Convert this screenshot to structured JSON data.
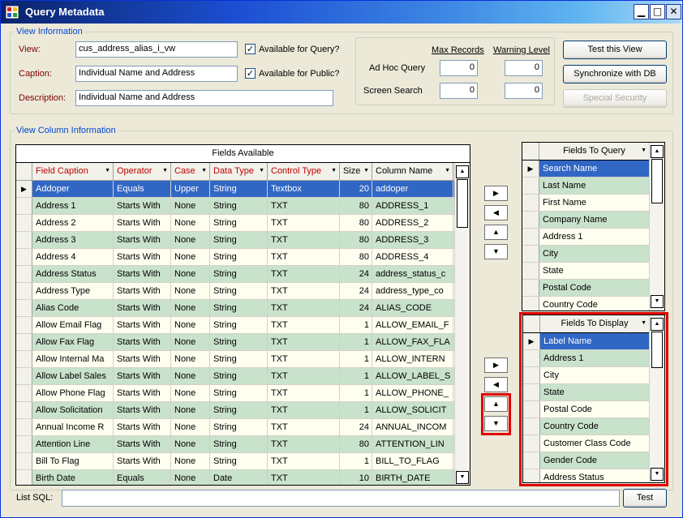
{
  "window": {
    "title": "Query Metadata"
  },
  "view_info": {
    "legend": "View Information",
    "view_label": "View:",
    "view_value": "cus_address_alias_i_vw",
    "caption_label": "Caption:",
    "caption_value": "Individual Name and Address",
    "description_label": "Description:",
    "description_value": "Individual Name and Address",
    "available_query_label": "Available for Query?",
    "available_query_checked": true,
    "available_public_label": "Available for Public?",
    "available_public_checked": true,
    "max_records_label": "Max Records",
    "warning_level_label": "Warning Level",
    "ad_hoc_label": "Ad Hoc Query",
    "screen_search_label": "Screen Search",
    "ad_hoc_max": "0",
    "ad_hoc_warning": "0",
    "screen_max": "0",
    "screen_warning": "0",
    "test_view_label": "Test this View",
    "sync_db_label": "Synchronize with DB",
    "special_security_label": "Special Security"
  },
  "column_info": {
    "legend": "View Column Information",
    "grid_title": "Fields Available",
    "columns": [
      "Field Caption",
      "Operator",
      "Case",
      "Data Type",
      "Control Type",
      "Size",
      "Column Name"
    ],
    "rows": [
      [
        "Addoper",
        "Equals",
        "Upper",
        "String",
        "Textbox",
        "20",
        "addoper"
      ],
      [
        "Address 1",
        "Starts With",
        "None",
        "String",
        "TXT",
        "80",
        "ADDRESS_1"
      ],
      [
        "Address 2",
        "Starts With",
        "None",
        "String",
        "TXT",
        "80",
        "ADDRESS_2"
      ],
      [
        "Address 3",
        "Starts With",
        "None",
        "String",
        "TXT",
        "80",
        "ADDRESS_3"
      ],
      [
        "Address 4",
        "Starts With",
        "None",
        "String",
        "TXT",
        "80",
        "ADDRESS_4"
      ],
      [
        "Address Status",
        "Starts With",
        "None",
        "String",
        "TXT",
        "24",
        "address_status_c"
      ],
      [
        "Address Type",
        "Starts With",
        "None",
        "String",
        "TXT",
        "24",
        "address_type_co"
      ],
      [
        "Alias Code",
        "Starts With",
        "None",
        "String",
        "TXT",
        "24",
        "ALIAS_CODE"
      ],
      [
        "Allow Email Flag",
        "Starts With",
        "None",
        "String",
        "TXT",
        "1",
        "ALLOW_EMAIL_F"
      ],
      [
        "Allow Fax Flag",
        "Starts With",
        "None",
        "String",
        "TXT",
        "1",
        "ALLOW_FAX_FLA"
      ],
      [
        "Allow Internal Ma",
        "Starts With",
        "None",
        "String",
        "TXT",
        "1",
        "ALLOW_INTERN"
      ],
      [
        "Allow Label Sales",
        "Starts With",
        "None",
        "String",
        "TXT",
        "1",
        "ALLOW_LABEL_S"
      ],
      [
        "Allow Phone Flag",
        "Starts With",
        "None",
        "String",
        "TXT",
        "1",
        "ALLOW_PHONE_"
      ],
      [
        "Allow Solicitation",
        "Starts With",
        "None",
        "String",
        "TXT",
        "1",
        "ALLOW_SOLICIT"
      ],
      [
        "Annual Income R",
        "Starts With",
        "None",
        "String",
        "TXT",
        "24",
        "ANNUAL_INCOM"
      ],
      [
        "Attention Line",
        "Starts With",
        "None",
        "String",
        "TXT",
        "80",
        "ATTENTION_LIN"
      ],
      [
        "Bill To Flag",
        "Starts With",
        "None",
        "String",
        "TXT",
        "1",
        "BILL_TO_FLAG"
      ],
      [
        "Birth Date",
        "Equals",
        "None",
        "Date",
        "TXT",
        "10",
        "BIRTH_DATE"
      ]
    ],
    "selected_row": 0
  },
  "fields_to_query": {
    "header": "Fields To Query",
    "items": [
      "Search Name",
      "Last Name",
      "First Name",
      "Company Name",
      "Address 1",
      "City",
      "State",
      "Postal Code",
      "Country Code"
    ],
    "selected": 0
  },
  "fields_to_display": {
    "header": "Fields To Display",
    "items": [
      "Label Name",
      "Address 1",
      "City",
      "State",
      "Postal Code",
      "Country Code",
      "Customer Class Code",
      "Gender Code",
      "Address Status"
    ],
    "selected": 0
  },
  "footer": {
    "list_sql_label": "List SQL:",
    "list_sql_value": "",
    "test_label": "Test"
  },
  "colors": {
    "selection": "#3167c4",
    "alt_row": "#c9e2cc",
    "highlight_box": "#e00000",
    "legend": "#0046d5"
  }
}
